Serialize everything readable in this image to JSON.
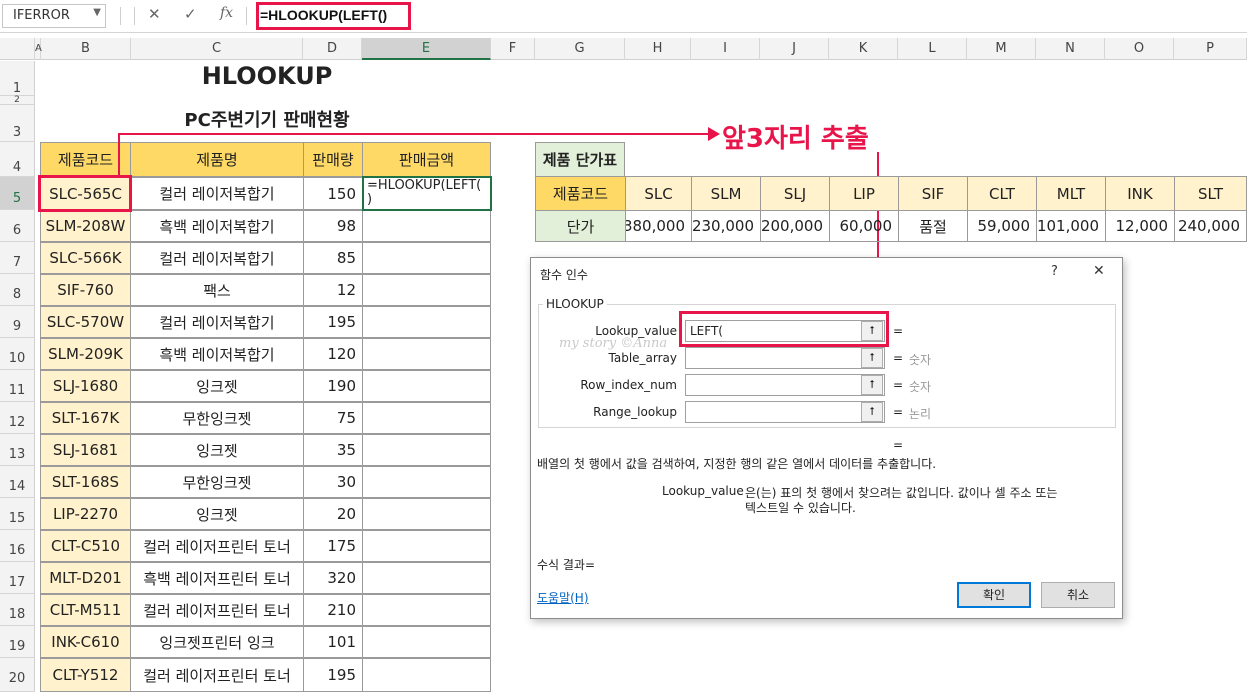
{
  "formula_bar": {
    "name_box": "IFERROR",
    "cancel_icon": "✕",
    "enter_icon": "✓",
    "fx_icon": "fx",
    "formula": "=HLOOKUP(LEFT()"
  },
  "columns": [
    "A",
    "B",
    "C",
    "D",
    "E",
    "F",
    "G",
    "H",
    "I",
    "J",
    "K",
    "L",
    "M",
    "N",
    "O",
    "P"
  ],
  "rows": [
    "1",
    "2",
    "3",
    "4",
    "5",
    "6",
    "7",
    "8",
    "9",
    "10",
    "11",
    "12",
    "13",
    "14",
    "15",
    "16",
    "17",
    "18",
    "19",
    "20"
  ],
  "sheet": {
    "title": "HLOOKUP",
    "subtitle": "PC주변기기 판매현황",
    "annotation": "앞3자리 추출",
    "table_headers": [
      "제품코드",
      "제품명",
      "판매량",
      "판매금액"
    ],
    "editing_cell_text": "=HLOOKUP(LEFT(\n)",
    "products": [
      {
        "code": "SLC-565C",
        "name": "컬러 레이저복합기",
        "qty": "150"
      },
      {
        "code": "SLM-208W",
        "name": "흑백 레이저복합기",
        "qty": "98"
      },
      {
        "code": "SLC-566K",
        "name": "컬러 레이저복합기",
        "qty": "85"
      },
      {
        "code": "SIF-760",
        "name": "팩스",
        "qty": "12"
      },
      {
        "code": "SLC-570W",
        "name": "컬러 레이저복합기",
        "qty": "195"
      },
      {
        "code": "SLM-209K",
        "name": "흑백 레이저복합기",
        "qty": "120"
      },
      {
        "code": "SLJ-1680",
        "name": "잉크젯",
        "qty": "190"
      },
      {
        "code": "SLT-167K",
        "name": "무한잉크젯",
        "qty": "75"
      },
      {
        "code": "SLJ-1681",
        "name": "잉크젯",
        "qty": "35"
      },
      {
        "code": "SLT-168S",
        "name": "무한잉크젯",
        "qty": "30"
      },
      {
        "code": "LIP-2270",
        "name": "잉크젯",
        "qty": "20"
      },
      {
        "code": "CLT-C510",
        "name": "컬러 레이저프린터 토너",
        "qty": "175"
      },
      {
        "code": "MLT-D201",
        "name": "흑백 레이저프린터 토너",
        "qty": "320"
      },
      {
        "code": "CLT-M511",
        "name": "컬러 레이저프린터 토너",
        "qty": "210"
      },
      {
        "code": "INK-C610",
        "name": "잉크젯프린터 잉크",
        "qty": "101"
      },
      {
        "code": "CLT-Y512",
        "name": "컬러 레이저프린터 토너",
        "qty": "195"
      }
    ],
    "price_table": {
      "title": "제품 단가표",
      "row1_label": "제품코드",
      "row2_label": "단가",
      "codes": [
        "SLC",
        "SLM",
        "SLJ",
        "LIP",
        "SIF",
        "CLT",
        "MLT",
        "INK",
        "SLT"
      ],
      "prices": [
        "380,000",
        "230,000",
        "200,000",
        "60,000",
        "품절",
        "59,000",
        "101,000",
        "12,000",
        "240,000"
      ]
    }
  },
  "dialog": {
    "title": "함수 인수",
    "help_icon": "?",
    "close_icon": "✕",
    "function_name": "HLOOKUP",
    "args": [
      {
        "label": "Lookup_value",
        "value": "LEFT(",
        "hint": ""
      },
      {
        "label": "Table_array",
        "value": "",
        "hint": "숫자"
      },
      {
        "label": "Row_index_num",
        "value": "",
        "hint": "숫자"
      },
      {
        "label": "Range_lookup",
        "value": "",
        "hint": "논리"
      }
    ],
    "equals": "=",
    "description": "배열의 첫 행에서 값을 검색하여, 지정한 행의 같은 열에서 데이터를 추출합니다.",
    "arg_name": "Lookup_value",
    "arg_description_1": "은(는) 표의 첫 행에서 찾으려는 값입니다. 값이나 셀 주소 또는",
    "arg_description_2": "텍스트일 수 있습니다.",
    "result_label": "수식 결과=",
    "help_link": "도움말(H)",
    "ok_button": "확인",
    "cancel_button": "취소",
    "watermark": "my story ©Anna"
  },
  "colors": {
    "highlight": "#e8154a",
    "header_fill": "#ffd966",
    "code_fill": "#fff2cc",
    "price_label_fill": "#e2efd9",
    "excel_green": "#217346"
  }
}
